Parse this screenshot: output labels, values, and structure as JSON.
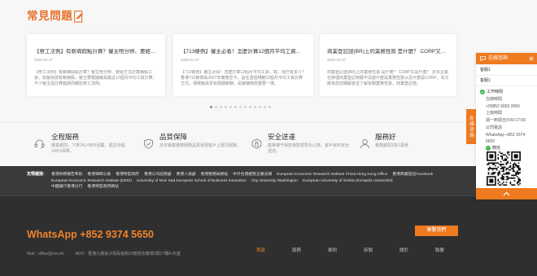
{
  "faq": {
    "title": "常見問題",
    "title_icon": "document-edit-icon",
    "cards": [
      {
        "title": "【勞工法例】有薪病假點計算？僱主唔分辨、要經方...",
        "date": "2026-01-27",
        "excerpt": "【勞工法例】有薪病假點計算？僱主唔分辨、要經方式計算病假工資，如僱員放有薪病假，僱主要根據僱員最近12個月平均工資計算，不少僱主因計算錯誤而觸犯勞工法例。"
      },
      {
        "title": "【713條例】僱主必看！怎麼計算12個月平均工資...",
        "date": "2026-01-27",
        "excerpt": "【713條例】僱主必看！怎麼計算12個月平均工資，咁，現已有多少？香港713條例由2007年實施至今，旨在透過規範12個月平均工資計算方式，保障僱員享有假期薪酬，是僱傭條例重要一環。"
      },
      {
        "title": "商業登記證(BR)上的業務性質 是什麼？ CORP又是什麼？",
        "date": "2026-01-27",
        "excerpt": "商業登記證(BR)上的業務性質 是什麼？ CORP又是什麼？ 許多企業在辦理商業登記時都不清楚什麼是業務性質以及什麼是CORP，本文將為您詳細解答並了解有關業務性質，商業登記證。"
      }
    ],
    "pagination": {
      "current_page": 1,
      "total_pages": 13
    }
  },
  "features": [
    {
      "icon": "headset-icon",
      "title": "全程服務",
      "desc": "專業顧問，下單24小時內回覆，隨訪流程100%保障。"
    },
    {
      "icon": "badge-icon",
      "title": "品質保障",
      "desc": "多年專業團隊服務品質保證客戶上層次服務。"
    },
    {
      "icon": "shield-icon",
      "title": "安全送達",
      "desc": "嚴格遵守保密條款標準化心態，客戶資料安全送達。"
    },
    {
      "icon": "user-icon",
      "title": "服務好",
      "desc": "專業顧問1對1溝通"
    }
  ],
  "links": {
    "label": "友情鏈接:",
    "rows": [
      [
        "香港財務報告準則",
        "香港律師公會",
        "香港特區政府",
        "香港公司註冊處",
        "香港入境處",
        "香港税務局網站",
        "中外合資經營企業法規",
        "European Economic Research Institute China Hong Kong Office",
        "香港商業登記Facebook"
      ],
      [
        "European Economic Research Institute (EERI)",
        "University of Novi Sad European School of Business Innovation",
        "City University Washington",
        "European University of Serbia (Evropski Univerzitet)"
      ],
      [
        "中國銀行香港分行",
        "香港特區政府網站"
      ]
    ]
  },
  "footer": {
    "whatsapp": "WhatsApp +852 9374 5650",
    "contact_button": "聯繫我們",
    "mail": "Mail：office@zso.hk",
    "address": "ADD：香港九龍長沙灣長裕街10號億京廣場2期17樓A 05室",
    "nav": [
      "首頁",
      "服務",
      "案例",
      "新聞",
      "關於",
      "聯繫"
    ],
    "active_nav": 0
  },
  "widget": {
    "side_tab": "在線咨詢",
    "title": "在線咨詢",
    "header_icon": "chat-bubble-icon",
    "close_icon": "close-icon",
    "agents": [
      "客服1",
      "客服1"
    ],
    "hours_label": "工作時間",
    "hours_icon": "check-circle-icon",
    "info_lines": [
      "在線時間",
      "+00852 6653 2066",
      "上班時間",
      "週一到週五9:00-17:00",
      "公司電話",
      "WhatsApp +852 9374 5650"
    ],
    "wechat_label": "微信",
    "wechat_icon": "wechat-icon",
    "back_to_top_icon": "chevron-up-icon"
  },
  "colors": {
    "accent": "#ef7a1f",
    "title_orange": "#e8712b",
    "whatsapp_orange": "#f0832a",
    "links_bg": "#3a3a3a",
    "footer_bg": "#2f2f2f",
    "green": "#3ab54a"
  }
}
